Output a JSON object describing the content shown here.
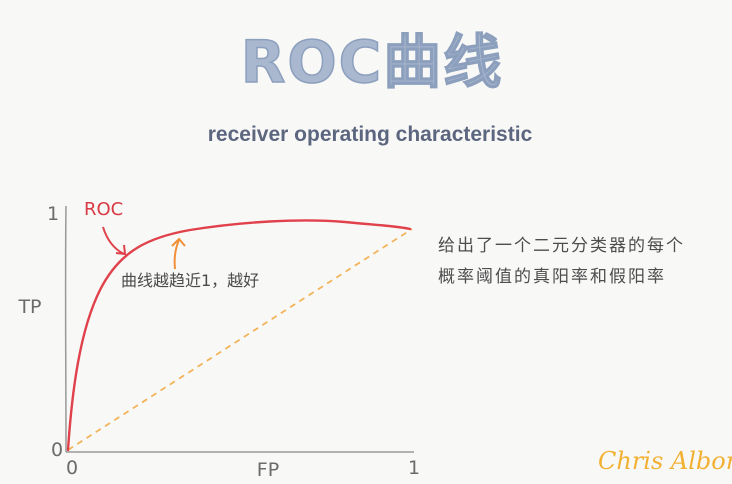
{
  "title": "ROC曲线",
  "subtitle": "receiver operating characteristic",
  "axes": {
    "y_label": "TP",
    "x_label": "FP",
    "y_tick_top": "1",
    "y_tick_bottom": "0",
    "x_tick_left": "0",
    "x_tick_right": "1"
  },
  "curve_label": "ROC",
  "annotation": "曲线越趋近1，越好",
  "note": {
    "line1": "给出了一个二元分类器的每个",
    "line2": "概率阈值的真阳率和假阳率"
  },
  "signature": "Chris Albon",
  "colors": {
    "title": "#a9b8cf",
    "subtitle": "#5d667f",
    "roc_curve": "#e0414b",
    "diagonal": "#f2b45a",
    "arrow_orange": "#f0913a",
    "signature": "#f2b133"
  }
}
